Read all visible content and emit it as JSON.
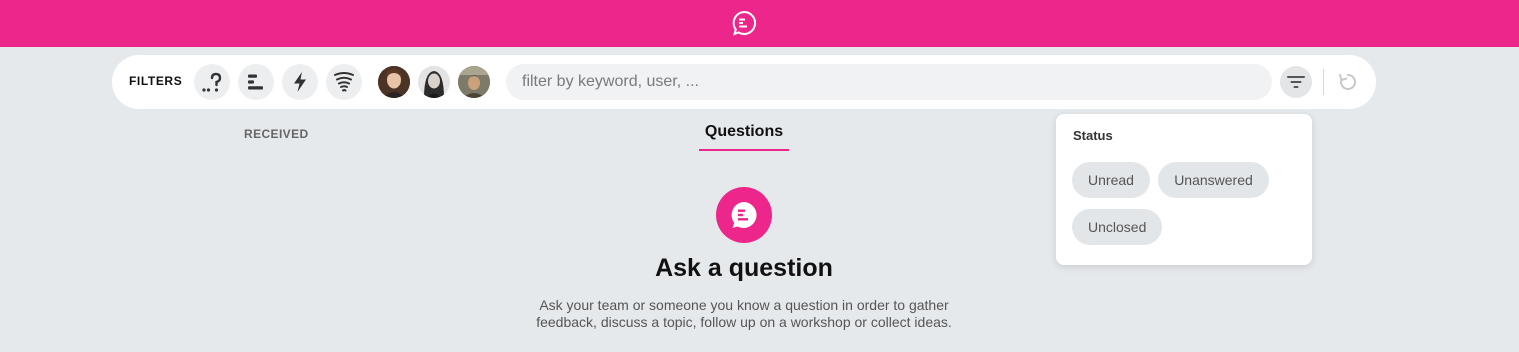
{
  "header": {
    "logo_icon": "chat-bubble-logo-icon",
    "brand_color": "#ed268b"
  },
  "filters": {
    "label": "FILTERS",
    "type_chips": [
      {
        "icon": "question-type-icon"
      },
      {
        "icon": "poll-bars-icon"
      },
      {
        "icon": "lightning-icon"
      },
      {
        "icon": "brainstorm-tornado-icon"
      }
    ],
    "users": [
      {
        "icon": "user-avatar-1"
      },
      {
        "icon": "user-avatar-2"
      },
      {
        "icon": "user-avatar-3"
      }
    ],
    "search": {
      "placeholder": "filter by keyword, user, ...",
      "value": ""
    },
    "filter_button_icon": "filter-lines-icon",
    "reset_button_icon": "reset-refresh-icon"
  },
  "tabs": {
    "received": "RECEIVED",
    "questions": "Questions",
    "active": "Questions"
  },
  "empty_state": {
    "icon": "chat-bubble-icon",
    "title": "Ask a question",
    "description": "Ask your team or someone you know a question in order to gather feedback, discuss a topic, follow up on a workshop or collect ideas."
  },
  "status_panel": {
    "title": "Status",
    "options": [
      "Unread",
      "Unanswered",
      "Unclosed"
    ]
  }
}
